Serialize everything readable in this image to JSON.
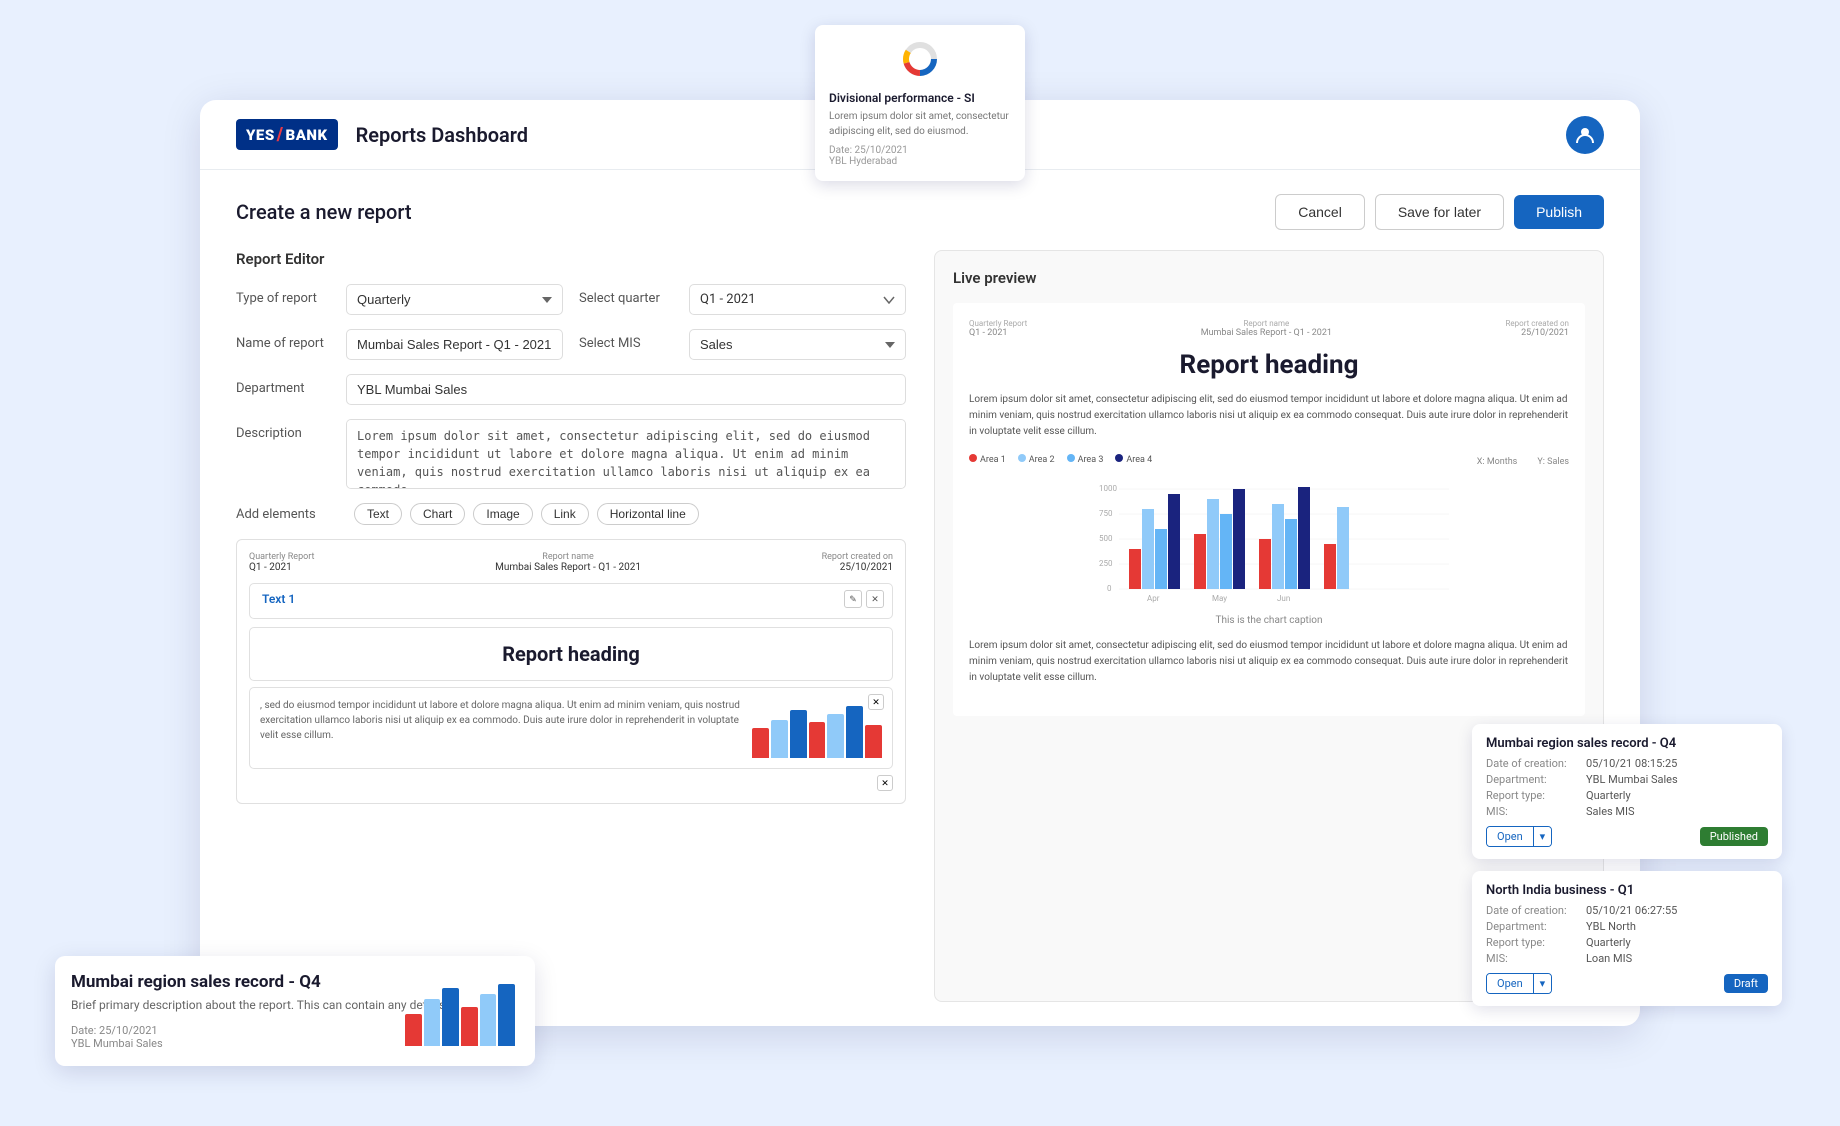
{
  "app": {
    "logo_text_left": "YES",
    "logo_slash": "/",
    "logo_text_right": "BANK",
    "title": "Reports Dashboard"
  },
  "header": {
    "cancel_btn": "Cancel",
    "save_btn": "Save for later",
    "publish_btn": "Publish"
  },
  "page": {
    "create_title": "Create a new report"
  },
  "editor": {
    "section_title": "Report Editor",
    "type_label": "Type of report",
    "type_value": "Quarterly",
    "name_label": "Name of report",
    "name_value": "Mumbai Sales Report - Q1 - 2021",
    "dept_label": "Department",
    "dept_value": "YBL Mumbai Sales",
    "desc_label": "Description",
    "desc_value": "Lorem ipsum dolor sit amet, consectetur adipiscing elit, sed do eiusmod tempor incididunt ut labore et dolore magna aliqua. Ut enim ad minim veniam, quis nostrud exercitation ullamco laboris nisi ut aliquip ex ea commodo.",
    "select_quarter_label": "Select quarter",
    "select_quarter_value": "Q1 - 2021",
    "select_mis_label": "Select MIS",
    "select_mis_value": "Sales",
    "add_elements_label": "Add elements",
    "elements": [
      "Text",
      "Chart",
      "Image",
      "Link",
      "Horizontal line"
    ],
    "text_elem_label": "Text 1",
    "report_heading": "Report heading",
    "chart_desc": ", sed do eiusmod tempor incididunt ut labore et dolore magna aliqua. Ut enim ad minim veniam, quis nostrud exercitation ullamco laboris nisi ut aliquip ex ea commodo. Duis aute irure dolor in reprehenderit in voluptate velit esse cillum."
  },
  "preview": {
    "section_title": "Live preview",
    "quarterly_label": "Quarterly Report",
    "quarter_value": "Q1 - 2021",
    "report_name_label": "Report name",
    "report_name_value": "Mumbai Sales Report - Q1 - 2021",
    "created_label": "Report created on",
    "created_value": "25/10/2021",
    "heading": "Report heading",
    "body_text": "Lorem ipsum dolor sit amet, consectetur adipiscing elit, sed do eiusmod tempor incididunt ut labore et dolore magna aliqua. Ut enim ad minim veniam, quis nostrud exercitation ullamco laboris nisi ut aliquip ex ea commodo consequat. Duis aute irure dolor in reprehenderit in voluptate velit esse cillum.",
    "chart_caption": "This is the chart caption",
    "axes_x": "X: Months",
    "axes_y": "Y: Sales",
    "legend": [
      "Area 1",
      "Area 2",
      "Area 3",
      "Area 4"
    ],
    "body_text2": "Lorem ipsum dolor sit amet, consectetur adipiscing elit, sed do eiusmod tempor incididunt ut labore et dolore magna aliqua. Ut enim ad minim veniam, quis nostrud exercitation ullamco laboris nisi ut aliquip ex ea commodo consequat. Duis aute irure dolor in reprehenderit in voluptate velit esse cillum."
  },
  "mini_report": {
    "quarterly_label": "Quarterly Report",
    "quarter_value": "Q1 - 2021",
    "report_name_label": "Report name",
    "report_name_value": "Mumbai Sales Report - Q1 - 2021",
    "created_label": "Report created on",
    "created_value": "25/10/2021"
  },
  "tooltip_card": {
    "title": "Divisional performance - SI",
    "description": "Lorem ipsum dolor sit amet, consectetur adipiscing elit, sed do eiusmod.",
    "date_label": "Date:",
    "date_value": "25/10/2021",
    "dept_value": "YBL Hyderabad"
  },
  "mumbai_card": {
    "title": "Mumbai region sales record - Q4",
    "description": "Brief primary description about the report. This can contain any details.",
    "date_label": "Date:",
    "date_value": "25/10/2021",
    "dept_value": "YBL Mumbai Sales"
  },
  "right_cards": [
    {
      "title": "Mumbai region sales record - Q4",
      "date_label": "Date of creation:",
      "date_value": "05/10/21 08:15:25",
      "dept_label": "Department:",
      "dept_value": "YBL Mumbai Sales",
      "type_label": "Report type:",
      "type_value": "Quarterly",
      "mis_label": "MIS:",
      "mis_value": "Sales MIS",
      "open_btn": "Open",
      "status": "Published"
    },
    {
      "title": "North India business - Q1",
      "date_label": "Date of creation:",
      "date_value": "05/10/21 06:27:55",
      "dept_label": "Department:",
      "dept_value": "YBL North",
      "type_label": "Report type:",
      "type_value": "Quarterly",
      "mis_label": "MIS:",
      "mis_value": "Loan MIS",
      "open_btn": "Open",
      "status": "Draft"
    }
  ],
  "colors": {
    "primary": "#1565c0",
    "red": "#e53935",
    "light_blue": "#64b5f6",
    "dark_blue": "#1a237e",
    "mid_blue": "#1976d2",
    "green": "#2e7d32",
    "area1": "#e53935",
    "area2": "#64b5f6",
    "area3": "#90caf9",
    "area4": "#1a237e"
  }
}
